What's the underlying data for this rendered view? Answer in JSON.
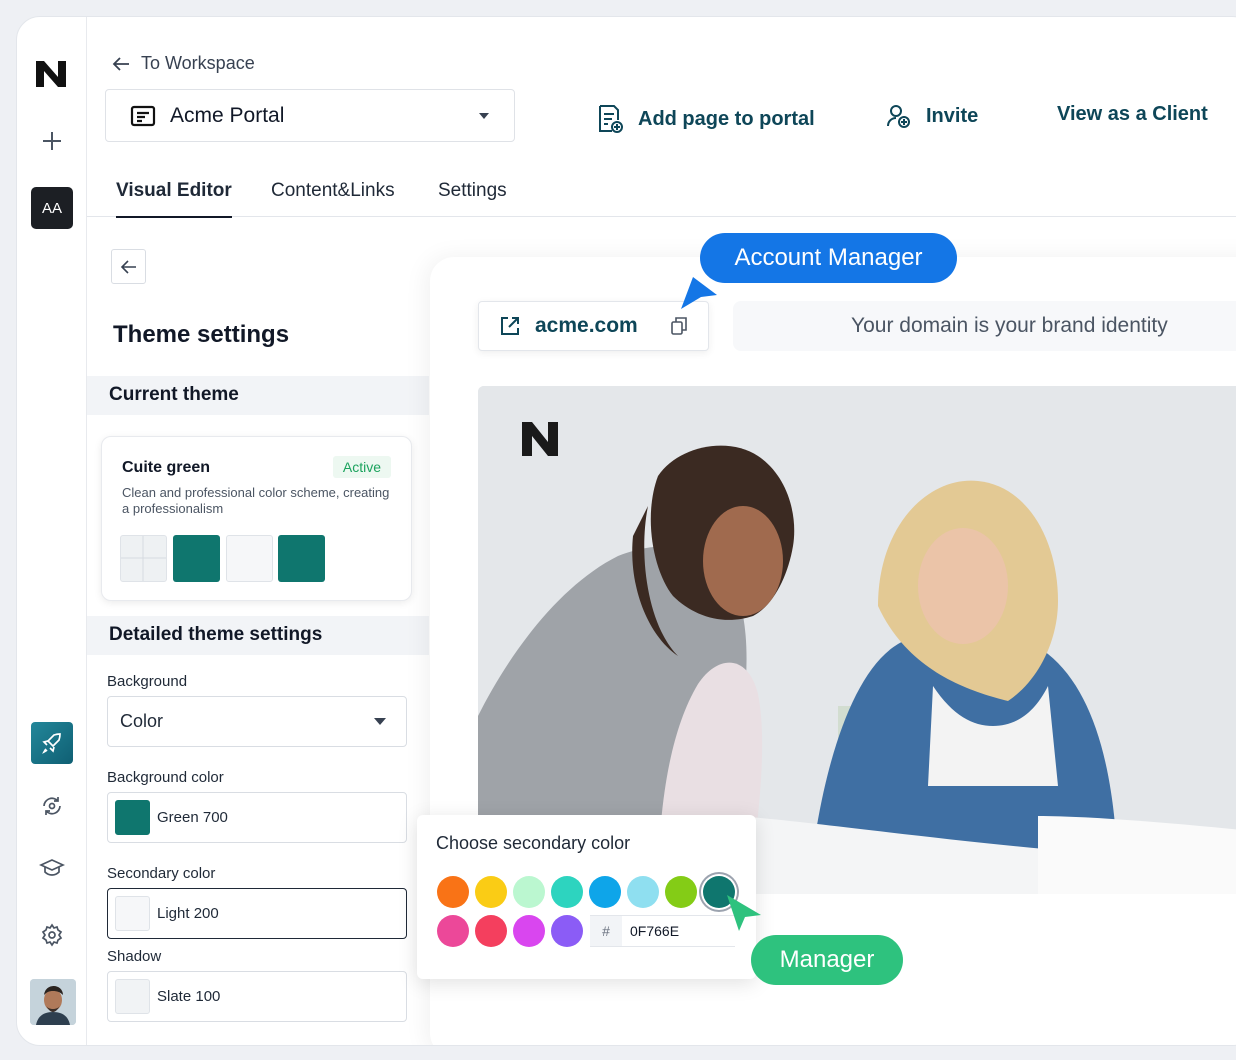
{
  "sidebar": {
    "logo_icon": "n-logo-icon",
    "add_icon": "plus-icon",
    "workspace_initials": "AA",
    "bottom_icons": [
      "rocket-icon",
      "sync-icon",
      "graduation-cap-icon",
      "gear-icon"
    ]
  },
  "header": {
    "back_label": "To Workspace",
    "portal_name": "Acme Portal",
    "add_page_label": "Add page to portal",
    "invite_label": "Invite",
    "view_client_label": "View as a Client"
  },
  "tabs": [
    {
      "label": "Visual Editor",
      "active": true
    },
    {
      "label": "Content&Links",
      "active": false
    },
    {
      "label": "Settings",
      "active": false
    }
  ],
  "panel": {
    "title": "Theme settings",
    "current_theme_heading": "Current theme",
    "theme": {
      "name": "Cuite green",
      "status": "Active",
      "description": "Clean and professional color scheme, creating a professionalism",
      "swatches": [
        "#eef1f3",
        "#0f766e",
        "#f6f7f9",
        "#0f766e"
      ]
    },
    "detailed_heading": "Detailed theme settings",
    "background_label": "Background",
    "background_value": "Color",
    "background_color_label": "Background color",
    "background_color_value": "Green 700",
    "secondary_color_label": "Secondary color",
    "secondary_color_value": "Light 200",
    "shadow_label": "Shadow",
    "shadow_value": "Slate 100"
  },
  "preview": {
    "domain": "acme.com",
    "domain_hint": "Your domain is your brand identity"
  },
  "color_picker": {
    "title": "Choose secondary color",
    "row1": [
      "#f97316",
      "#facc15",
      "#bbf7d0",
      "#2dd4bf",
      "#0ea5e9",
      "#8fdff0",
      "#84cc16",
      "#0f766e"
    ],
    "row2": [
      "#ec4899",
      "#f43f5e",
      "#d946ef",
      "#8b5cf6"
    ],
    "hash": "#",
    "hex_value": "0F766E"
  },
  "annotations": {
    "account_manager": "Account Manager",
    "manager": "Manager"
  },
  "colors": {
    "brand_dark": "#0e4658",
    "primary_blue": "#1476e6",
    "manager_green": "#2ec27e"
  }
}
